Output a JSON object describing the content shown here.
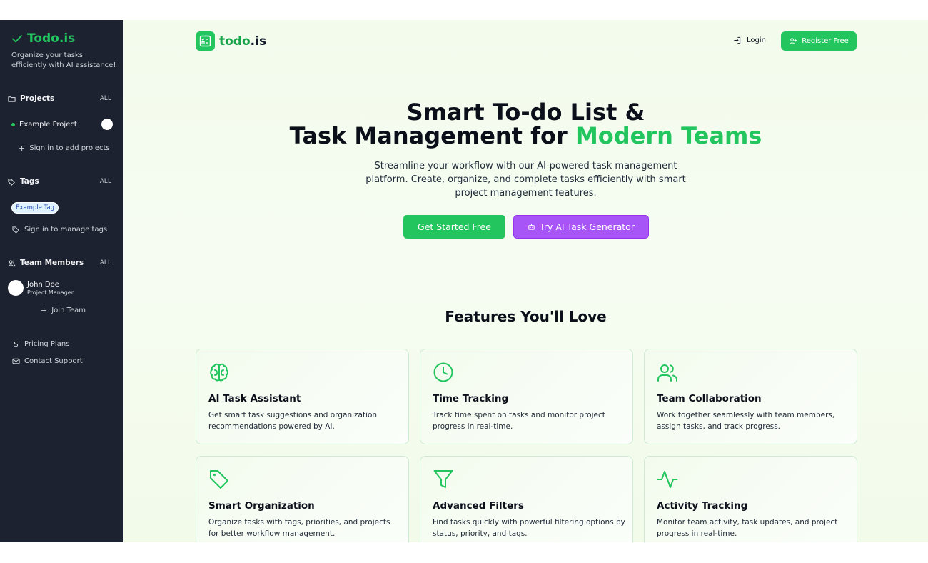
{
  "sidebar": {
    "brand": "Todo.is",
    "tagline": "Organize your tasks efficiently with AI assistance!",
    "projects": {
      "title": "Projects",
      "all": "ALL",
      "items": [
        {
          "label": "Example Project"
        }
      ],
      "add": "Sign in to add projects"
    },
    "tags": {
      "title": "Tags",
      "all": "ALL",
      "items": [
        {
          "label": "Example Tag"
        }
      ],
      "manage": "Sign in to manage tags"
    },
    "team": {
      "title": "Team Members",
      "all": "ALL",
      "members": [
        {
          "name": "John Doe",
          "role": "Project Manager"
        }
      ],
      "join": "Join Team"
    },
    "links": {
      "pricing": "Pricing Plans",
      "contact": "Contact Support"
    }
  },
  "header": {
    "logo_prefix": "todo",
    "logo_dot": ".",
    "logo_suffix": "is",
    "login": "Login",
    "register": "Register Free"
  },
  "hero": {
    "title_line1": "Smart To-do List &",
    "title_line2_main": "Task Management for ",
    "title_line2_accent": "Modern Teams",
    "subtitle": "Streamline your workflow with our AI-powered task management platform. Create, organize, and complete tasks efficiently with smart project management features.",
    "primary_cta": "Get Started Free",
    "secondary_cta": "Try AI Task Generator"
  },
  "features": {
    "title": "Features You'll Love",
    "items": [
      {
        "icon": "brain-icon",
        "title": "AI Task Assistant",
        "desc": "Get smart task suggestions and organization recommendations powered by AI."
      },
      {
        "icon": "clock-icon",
        "title": "Time Tracking",
        "desc": "Track time spent on tasks and monitor project progress in real-time."
      },
      {
        "icon": "users-icon",
        "title": "Team Collaboration",
        "desc": "Work together seamlessly with team members, assign tasks, and track progress."
      },
      {
        "icon": "tag-icon",
        "title": "Smart Organization",
        "desc": "Organize tasks with tags, priorities, and projects for better workflow management."
      },
      {
        "icon": "filter-icon",
        "title": "Advanced Filters",
        "desc": "Find tasks quickly with powerful filtering options by status, priority, and tags."
      },
      {
        "icon": "activity-icon",
        "title": "Activity Tracking",
        "desc": "Monitor team activity, task updates, and project progress in real-time."
      }
    ]
  },
  "colors": {
    "accent": "#22c55e",
    "secondary": "#a855f7",
    "sidebar_bg": "#1c2230"
  }
}
